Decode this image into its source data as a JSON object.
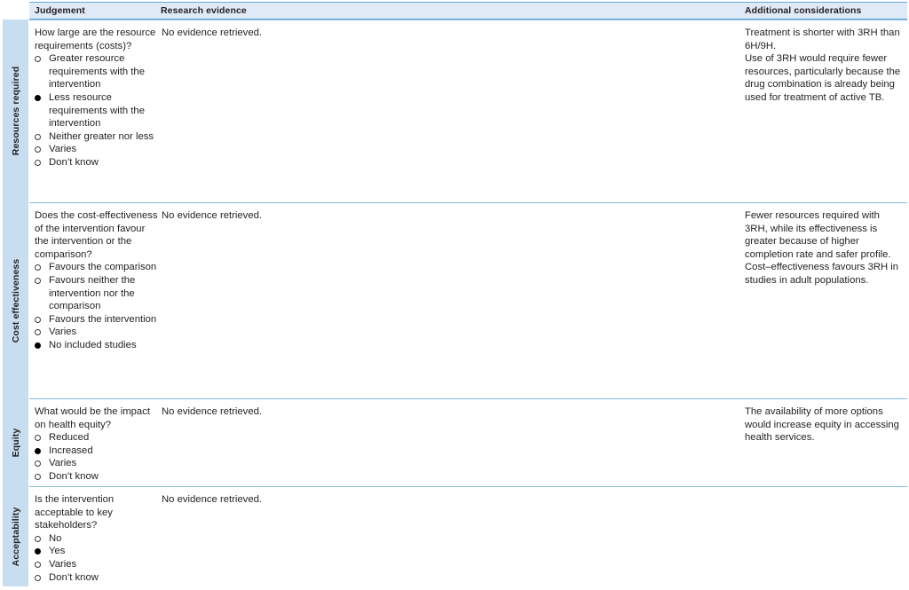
{
  "table": {
    "columns": {
      "judgement": "Judgement",
      "research_evidence": "Research evidence",
      "additional_considerations": "Additional considerations"
    },
    "rows": [
      {
        "criterion": "Resources required",
        "question": "How large are the resource requirements (costs)?",
        "options": [
          {
            "label": "Greater resource requirements with the intervention",
            "selected": false
          },
          {
            "label": "Less resource requirements with the intervention",
            "selected": true
          },
          {
            "label": "Neither greater nor less",
            "selected": false
          },
          {
            "label": "Varies",
            "selected": false
          },
          {
            "label": "Don’t know",
            "selected": false
          }
        ],
        "research_evidence": "No evidence retrieved.",
        "additional_considerations": "Treatment is shorter with 3RH than 6H/9H.\nUse of 3RH would require fewer resources, particularly because the drug combination is already being used for treatment of active TB."
      },
      {
        "criterion": "Cost effectiveness",
        "question": "Does the cost-effectiveness of the intervention favour the intervention or the comparison?",
        "options": [
          {
            "label": "Favours the comparison",
            "selected": false
          },
          {
            "label": "Favours neither the intervention nor the comparison",
            "selected": false
          },
          {
            "label": "Favours the intervention",
            "selected": false
          },
          {
            "label": "Varies",
            "selected": false
          },
          {
            "label": "No included studies",
            "selected": true
          }
        ],
        "research_evidence": "No evidence retrieved.",
        "additional_considerations": "Fewer resources required with 3RH, while its effectiveness is greater because of higher completion rate and safer profile. Cost–effectiveness favours 3RH in studies in adult populations."
      },
      {
        "criterion": "Equity",
        "question": "What would be the impact on health equity?",
        "options": [
          {
            "label": "Reduced",
            "selected": false
          },
          {
            "label": "Increased",
            "selected": true
          },
          {
            "label": "Varies",
            "selected": false
          },
          {
            "label": "Don’t know",
            "selected": false
          }
        ],
        "research_evidence": "No evidence retrieved.",
        "additional_considerations": "The availability of more options would increase equity in accessing health services."
      },
      {
        "criterion": "Acceptability",
        "question": "Is the intervention acceptable to key stakeholders?",
        "options": [
          {
            "label": "No",
            "selected": false
          },
          {
            "label": "Yes",
            "selected": true
          },
          {
            "label": "Varies",
            "selected": false
          },
          {
            "label": "Don’t know",
            "selected": false
          }
        ],
        "research_evidence": "No evidence retrieved.",
        "additional_considerations": ""
      }
    ],
    "colors": {
      "header_background": "#dfeaf6",
      "header_rule": "#6aa6d6",
      "row_rule": "#84bbe3",
      "side_band": "#c7ddf0",
      "text": "#231f20"
    }
  }
}
